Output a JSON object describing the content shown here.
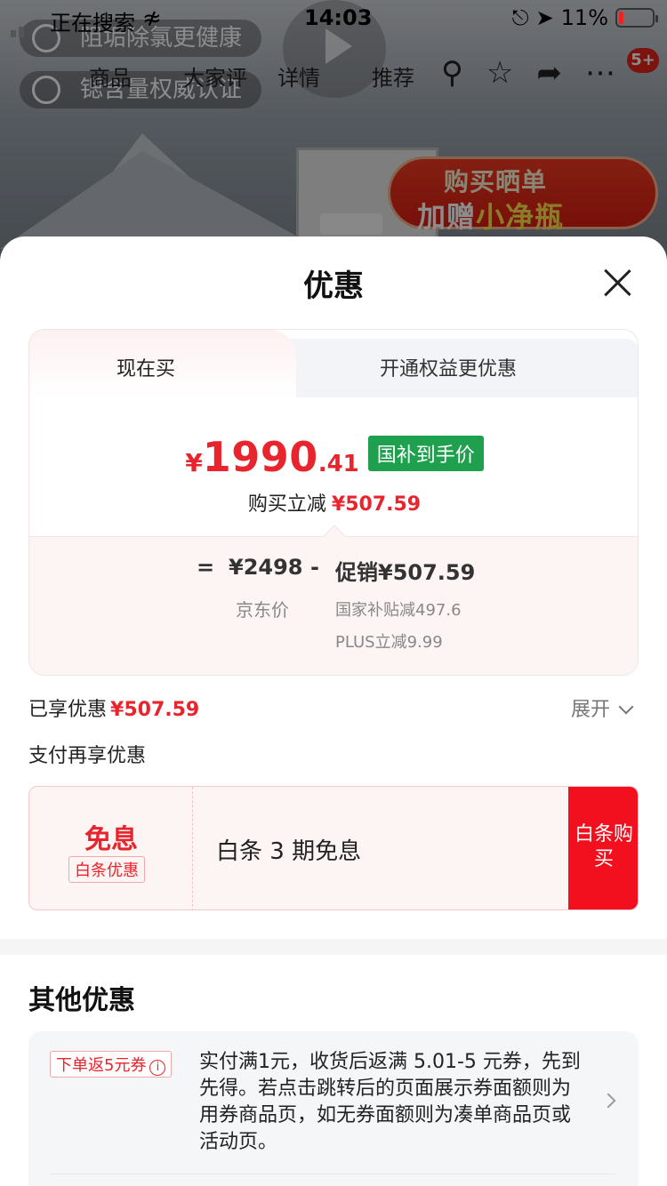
{
  "status_bar": {
    "carrier": "正在搜索",
    "time": "14:03",
    "battery": "11%"
  },
  "background": {
    "pills": [
      "阻垢除氯更健康",
      "锶含量权威认证"
    ],
    "tabs": [
      "商品",
      "大家评",
      "详情",
      "推荐"
    ],
    "cart_badge": "5+",
    "promo_line1": "购买晒单",
    "promo_line2a": "加赠",
    "promo_line2b": "小净瓶"
  },
  "sheet": {
    "title": "优惠",
    "tabs": {
      "active": "现在买",
      "inactive": "开通权益更优惠"
    },
    "price": {
      "currency": "¥",
      "integer": "1990",
      "decimal": ".41",
      "tag": "国补到手价"
    },
    "reduce": {
      "label": "购买立减",
      "amount": "¥507.59"
    },
    "breakdown": {
      "equals": "=",
      "base_price": "¥2498",
      "minus": "-",
      "promo": "促销¥507.59",
      "base_label": "京东价",
      "sub1": "国家补贴减497.6",
      "sub2": "PLUS立减9.99"
    },
    "enjoyed": {
      "label": "已享优惠",
      "amount": "¥507.59"
    },
    "expand_label": "展开",
    "pay_section_title": "支付再享优惠",
    "pay_offer": {
      "headline": "免息",
      "tag": "白条优惠",
      "text": "白条 3 期免息",
      "button": "白条购买"
    },
    "other_title": "其他优惠",
    "coupon": {
      "tag": "下单返5元券",
      "info_icon": "i",
      "desc": "实付满1元，收货后返满 5.01-5 元券，先到先得。若点击跳转后的页面展示券面额则为用券商品页，如无券面额则为凑单商品页或活动页。"
    }
  }
}
